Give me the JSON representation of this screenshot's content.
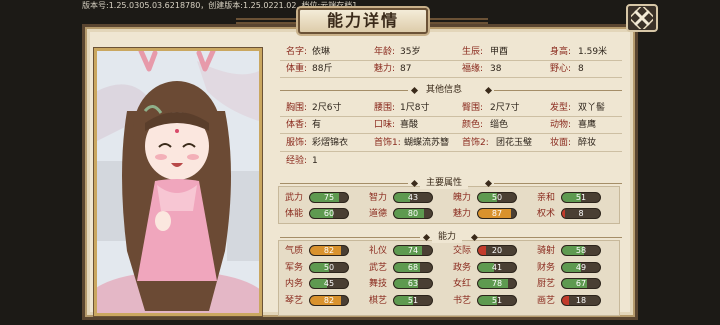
{
  "version_text": "版本号:1.25.0305.03.6218780，创建版本:1.25.0221.02, 档位:云端存档1",
  "title": "能力详情",
  "profile": {
    "rows": [
      [
        {
          "label": "名字:",
          "value": "依琳"
        },
        {
          "label": "年龄:",
          "value": "35岁"
        },
        {
          "label": "生辰:",
          "value": "甲酉"
        },
        {
          "label": "身高:",
          "value": "1.59米"
        }
      ],
      [
        {
          "label": "体重:",
          "value": "88斤"
        },
        {
          "label": "魅力:",
          "value": "87"
        },
        {
          "label": "福缘:",
          "value": "38"
        },
        {
          "label": "野心:",
          "value": "8"
        }
      ]
    ],
    "other_title": "其他信息",
    "other_rows": [
      [
        {
          "label": "胸围:",
          "value": "2尺6寸"
        },
        {
          "label": "腰围:",
          "value": "1尺8寸"
        },
        {
          "label": "臀围:",
          "value": "2尺7寸"
        },
        {
          "label": "发型:",
          "value": "双丫髻"
        }
      ],
      [
        {
          "label": "体香:",
          "value": "有"
        },
        {
          "label": "口味:",
          "value": "喜酸"
        },
        {
          "label": "颜色:",
          "value": "缁色"
        },
        {
          "label": "动物:",
          "value": "喜鹰"
        }
      ],
      [
        {
          "label": "服饰:",
          "value": "彩熠锦衣"
        },
        {
          "label": "首饰1:",
          "value": "蝴蝶流苏簪"
        },
        {
          "label": "首饰2:",
          "value": "团花玉璧"
        },
        {
          "label": "妆面:",
          "value": "醉妆"
        }
      ],
      [
        {
          "label": "经验:",
          "value": "1"
        }
      ]
    ]
  },
  "main_attrs": {
    "title": "主要属性",
    "items": [
      {
        "name": "武力",
        "value": "75",
        "color": "green",
        "pct": 0.75
      },
      {
        "name": "智力",
        "value": "43",
        "color": "green",
        "pct": 0.43
      },
      {
        "name": "魄力",
        "value": "50",
        "color": "green",
        "pct": 0.5
      },
      {
        "name": "亲和",
        "value": "51",
        "color": "green",
        "pct": 0.51
      },
      {
        "name": "体能",
        "value": "60",
        "color": "green",
        "pct": 0.6
      },
      {
        "name": "道德",
        "value": "80",
        "color": "green",
        "pct": 0.8
      },
      {
        "name": "魅力",
        "value": "87",
        "color": "gold",
        "pct": 0.87
      },
      {
        "name": "权术",
        "value": "8",
        "color": "red",
        "pct": 0.08
      }
    ]
  },
  "abilities": {
    "title": "能力",
    "items": [
      {
        "name": "气质",
        "value": "82",
        "color": "gold",
        "pct": 0.82
      },
      {
        "name": "礼仪",
        "value": "74",
        "color": "green",
        "pct": 0.74
      },
      {
        "name": "交际",
        "value": "20",
        "color": "red",
        "pct": 0.2
      },
      {
        "name": "骑射",
        "value": "58",
        "color": "green",
        "pct": 0.58
      },
      {
        "name": "军务",
        "value": "50",
        "color": "green",
        "pct": 0.5
      },
      {
        "name": "武艺",
        "value": "68",
        "color": "green",
        "pct": 0.68
      },
      {
        "name": "政务",
        "value": "41",
        "color": "green",
        "pct": 0.41
      },
      {
        "name": "财务",
        "value": "49",
        "color": "green",
        "pct": 0.49
      },
      {
        "name": "内务",
        "value": "45",
        "color": "green",
        "pct": 0.45
      },
      {
        "name": "舞技",
        "value": "63",
        "color": "green",
        "pct": 0.63
      },
      {
        "name": "女红",
        "value": "78",
        "color": "green",
        "pct": 0.78
      },
      {
        "name": "厨艺",
        "value": "67",
        "color": "green",
        "pct": 0.67
      },
      {
        "name": "琴艺",
        "value": "82",
        "color": "gold",
        "pct": 0.82
      },
      {
        "name": "棋艺",
        "value": "51",
        "color": "green",
        "pct": 0.51
      },
      {
        "name": "书艺",
        "value": "51",
        "color": "green",
        "pct": 0.51
      },
      {
        "name": "画艺",
        "value": "18",
        "color": "red",
        "pct": 0.18
      }
    ]
  },
  "icons": {
    "close": "close-x-icon",
    "portrait": "character-portrait"
  },
  "colors": {
    "label": "#8a2a1e",
    "green": "#5e9a50",
    "gold": "#d9922d",
    "red": "#c23b2b",
    "frame": "#5a4530"
  }
}
